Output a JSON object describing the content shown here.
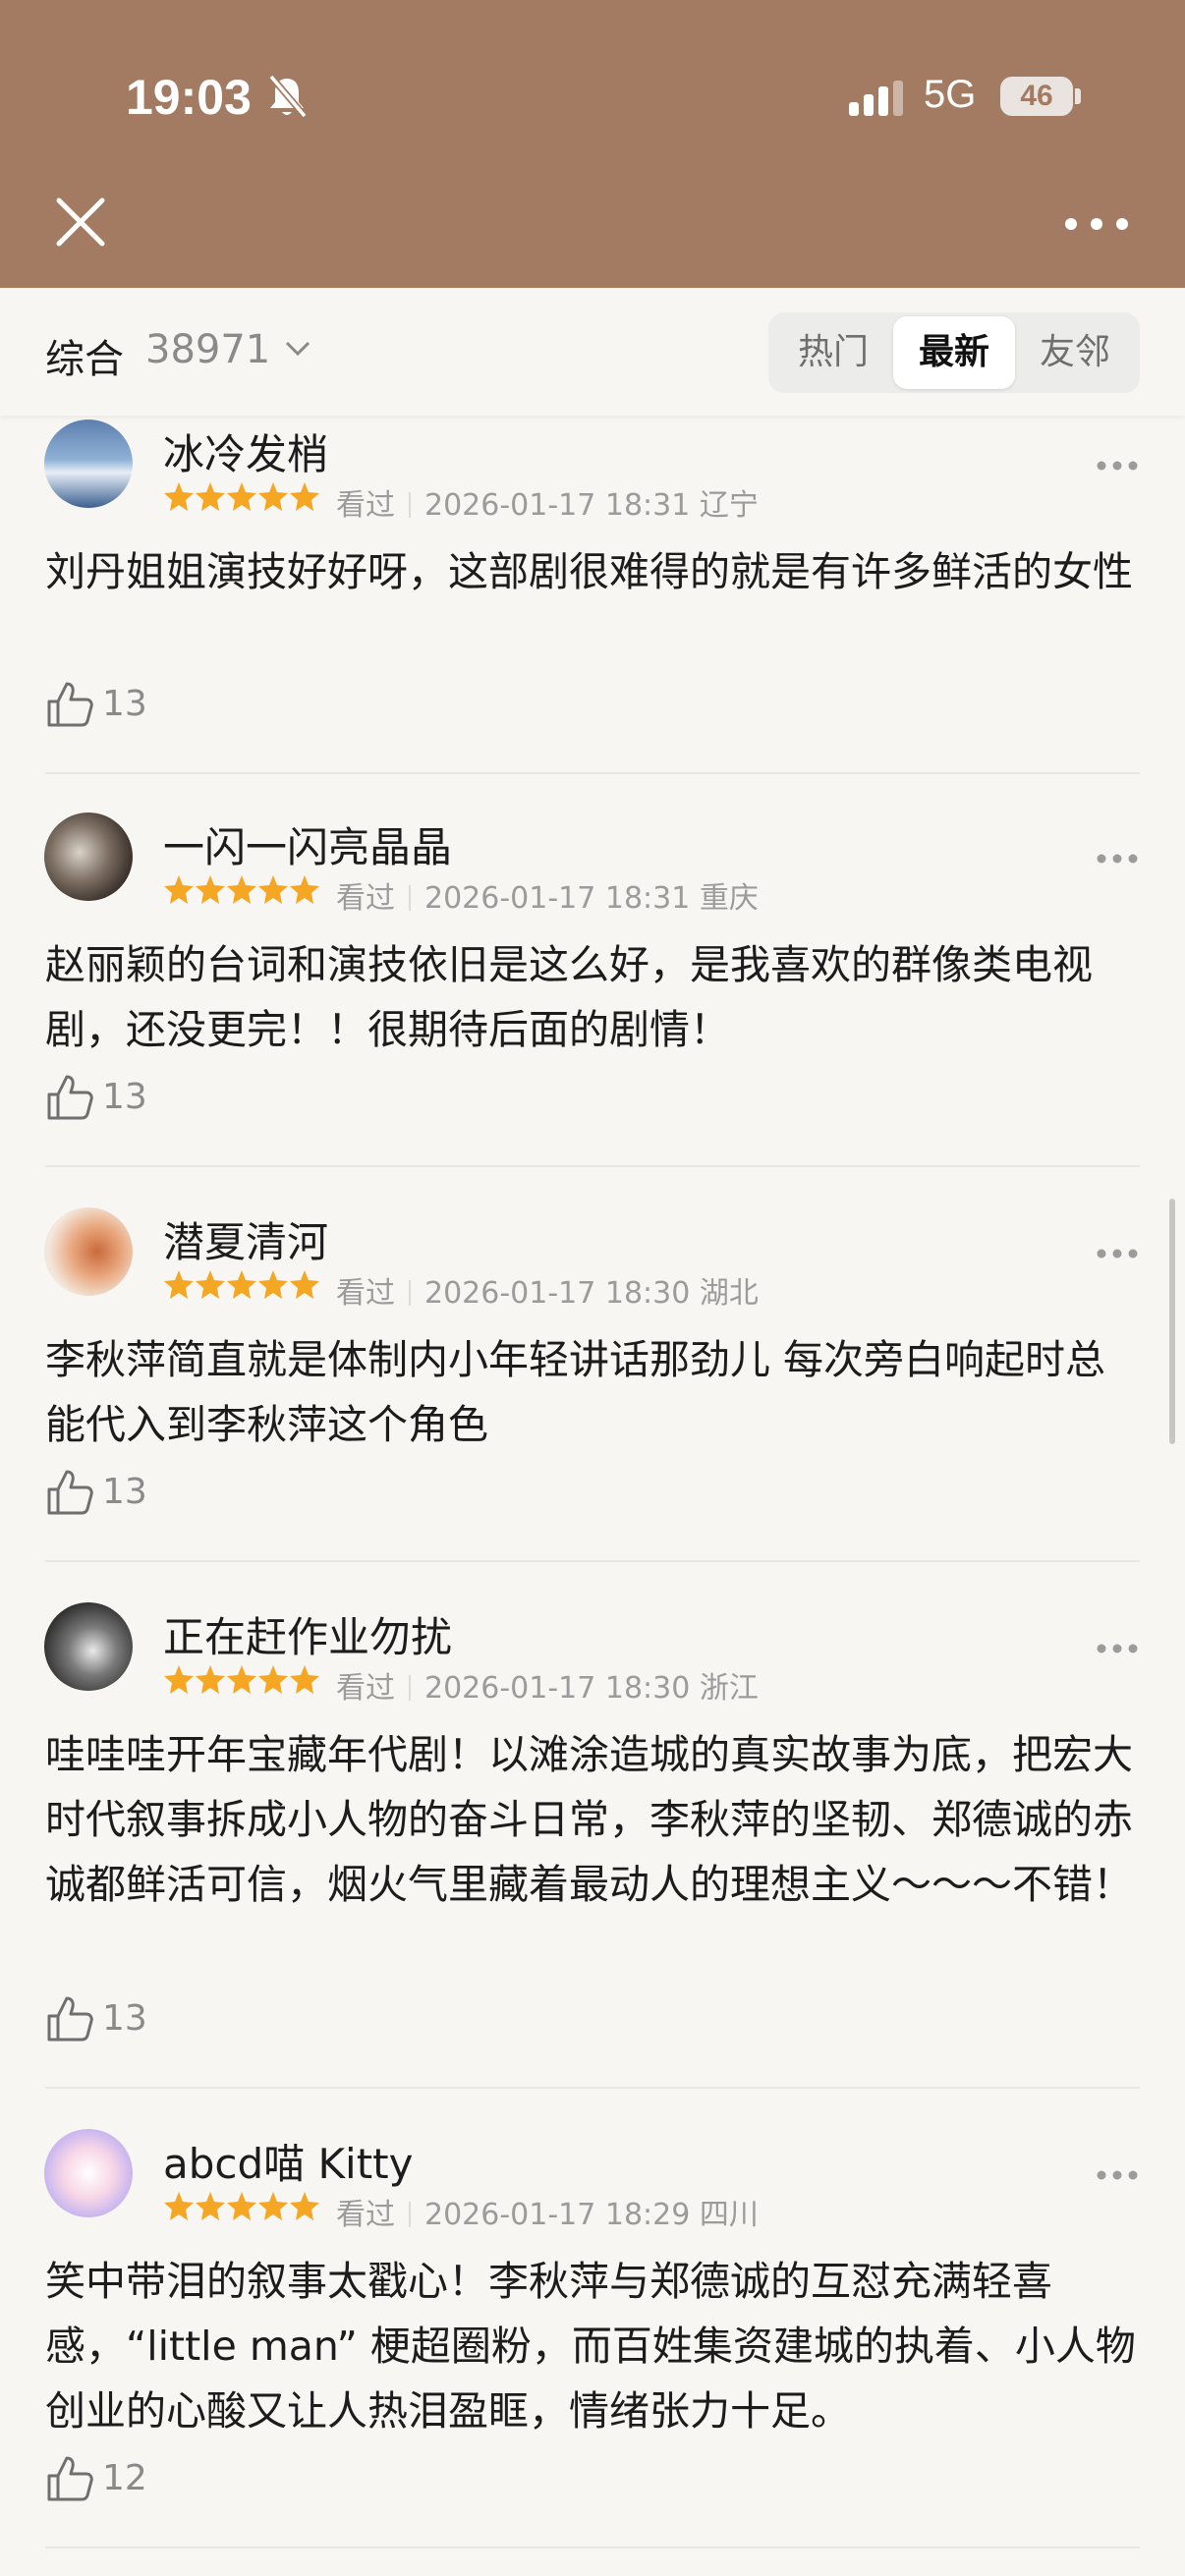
{
  "status_bar": {
    "time": "19:03",
    "network": "5G",
    "battery": "46"
  },
  "filter": {
    "title": "综合",
    "count": "38971",
    "tabs": [
      {
        "label": "热门",
        "active": false
      },
      {
        "label": "最新",
        "active": true
      },
      {
        "label": "友邻",
        "active": false
      }
    ]
  },
  "comments": [
    {
      "user": "冰冷发梢",
      "rating": 5,
      "status": "看过",
      "time": "2026-01-17 18:31",
      "location": "辽宁",
      "text": "刘丹姐姐演技好好呀，这部剧很难得的就是有许多鲜活的女性",
      "likes": "13"
    },
    {
      "user": "一闪一闪亮晶晶",
      "rating": 5,
      "status": "看过",
      "time": "2026-01-17 18:31",
      "location": "重庆",
      "text": "赵丽颖的台词和演技依旧是这么好，是我喜欢的群像类电视剧，还没更完！！很期待后面的剧情！",
      "likes": "13"
    },
    {
      "user": "潜夏清河",
      "rating": 5,
      "status": "看过",
      "time": "2026-01-17 18:30",
      "location": "湖北",
      "text": "李秋萍简直就是体制内小年轻讲话那劲儿 每次旁白响起时总能代入到李秋萍这个角色",
      "likes": "13"
    },
    {
      "user": "正在赶作业勿扰",
      "rating": 5,
      "status": "看过",
      "time": "2026-01-17 18:30",
      "location": "浙江",
      "text": "哇哇哇开年宝藏年代剧！以滩涂造城的真实故事为底，把宏大时代叙事拆成小人物的奋斗日常，李秋萍的坚韧、郑德诚的赤诚都鲜活可信，烟火气里藏着最动人的理想主义～～～不错！",
      "likes": "13"
    },
    {
      "user": "abcd喵 Kitty",
      "rating": 5,
      "status": "看过",
      "time": "2026-01-17 18:29",
      "location": "四川",
      "text": "笑中带泪的叙事太戳心！李秋萍与郑德诚的互怼充满轻喜感，“little man” 梗超圈粉，而百姓集资建城的执着、小人物创业的心酸又让人热泪盈眶，情绪张力十足。",
      "likes": "12"
    }
  ],
  "colors": {
    "header_bg": "#a37b62",
    "star": "#f5a623",
    "page_bg": "#f7f6f3"
  }
}
